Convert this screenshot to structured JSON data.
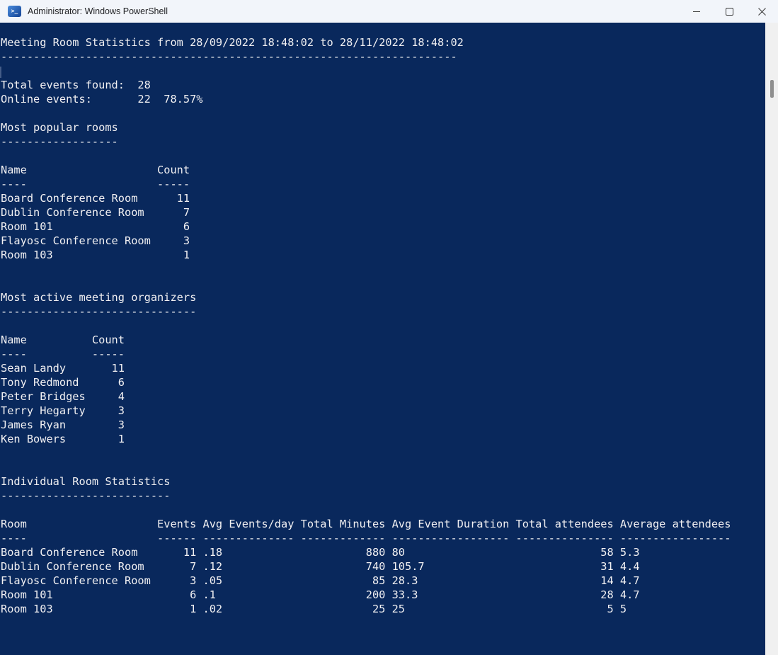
{
  "window": {
    "title": "Administrator: Windows PowerShell",
    "icon": "powershell-icon",
    "controls": {
      "minimize": "minimize",
      "maximize": "maximize",
      "close": "close"
    }
  },
  "theme": {
    "console_background": "#09285c",
    "console_text": "#f1f0f2",
    "titlebar_background": "#f2f5fa",
    "scrollbar_track": "#f0f0f0",
    "scrollbar_thumb": "#8f8f8f"
  },
  "report": {
    "title": "Meeting Room Statistics from 28/09/2022 18:48:02 to 28/11/2022 18:48:02",
    "summary": {
      "total_events_label": "Total events found:",
      "total_events": "28",
      "online_events_label": "Online events:",
      "online_events": "22",
      "online_events_percent": "78.57%"
    },
    "most_popular_rooms": {
      "heading": "Most popular rooms",
      "headers": [
        "Name",
        "Count"
      ],
      "rows": [
        [
          "Board Conference Room",
          "11"
        ],
        [
          "Dublin Conference Room",
          "7"
        ],
        [
          "Room 101",
          "6"
        ],
        [
          "Flayosc Conference Room",
          "3"
        ],
        [
          "Room 103",
          "1"
        ]
      ]
    },
    "most_active_organizers": {
      "heading": "Most active meeting organizers",
      "headers": [
        "Name",
        "Count"
      ],
      "rows": [
        [
          "Sean Landy",
          "11"
        ],
        [
          "Tony Redmond",
          "6"
        ],
        [
          "Peter Bridges",
          "4"
        ],
        [
          "Terry Hegarty",
          "3"
        ],
        [
          "James Ryan",
          "3"
        ],
        [
          "Ken Bowers",
          "1"
        ]
      ]
    },
    "individual_room_statistics": {
      "heading": "Individual Room Statistics",
      "headers": [
        "Room",
        "Events",
        "Avg Events/day",
        "Total Minutes",
        "Avg Event Duration",
        "Total attendees",
        "Average attendees"
      ],
      "rows": [
        [
          "Board Conference Room",
          "11",
          ".18",
          "880",
          "80",
          "58",
          "5.3"
        ],
        [
          "Dublin Conference Room",
          "7",
          ".12",
          "740",
          "105.7",
          "31",
          "4.4"
        ],
        [
          "Flayosc Conference Room",
          "3",
          ".05",
          "85",
          "28.3",
          "14",
          "4.7"
        ],
        [
          "Room 101",
          "6",
          ".1",
          "200",
          "33.3",
          "28",
          "4.7"
        ],
        [
          "Room 103",
          "1",
          ".02",
          "25",
          "25",
          "5",
          "5"
        ]
      ]
    }
  },
  "console": {
    "lines": [
      "Meeting Room Statistics from 28/09/2022 18:48:02 to 28/11/2022 18:48:02",
      "----------------------------------------------------------------------",
      "",
      "Total events found:  28",
      "Online events:       22  78.57%",
      "",
      "Most popular rooms",
      "------------------",
      "",
      "Name                    Count",
      "----                    -----",
      "Board Conference Room      11",
      "Dublin Conference Room      7",
      "Room 101                    6",
      "Flayosc Conference Room     3",
      "Room 103                    1",
      "",
      "",
      "Most active meeting organizers",
      "------------------------------",
      "",
      "Name          Count",
      "----          -----",
      "Sean Landy       11",
      "Tony Redmond      6",
      "Peter Bridges     4",
      "Terry Hegarty     3",
      "James Ryan        3",
      "Ken Bowers        1",
      "",
      "",
      "Individual Room Statistics",
      "--------------------------",
      "",
      "Room                    Events Avg Events/day Total Minutes Avg Event Duration Total attendees Average attendees",
      "----                    ------ -------------- ------------- ------------------ --------------- -----------------",
      "Board Conference Room       11 .18                      880 80                              58 5.3",
      "Dublin Conference Room       7 .12                      740 105.7                           31 4.4",
      "Flayosc Conference Room      3 .05                       85 28.3                            14 4.7",
      "Room 101                     6 .1                       200 33.3                            28 4.7",
      "Room 103                     1 .02                       25 25                               5 5",
      "",
      "",
      ""
    ]
  }
}
